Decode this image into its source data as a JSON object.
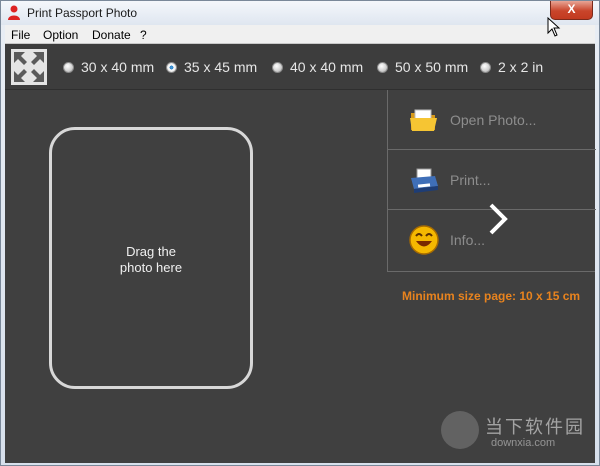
{
  "window": {
    "title": "Print Passport Photo",
    "close_label": "X"
  },
  "menu": [
    "File",
    "Option",
    "Donate",
    "?"
  ],
  "sizes": {
    "options": [
      "30 x 40 mm",
      "35 x 45 mm",
      "40 x 40 mm",
      "50 x 50 mm",
      "2 x 2 in"
    ],
    "selected": "35 x 45 mm"
  },
  "drop_zone": {
    "line1": "Drag the",
    "line2": "photo here"
  },
  "actions": {
    "open": "Open Photo...",
    "print": "Print...",
    "info": "Info..."
  },
  "min_size_text": "Minimum size page: 10 x 15 cm",
  "watermark": {
    "title": "当下软件园",
    "subtitle": "downxia.com"
  },
  "colors": {
    "accent_orange": "#e8831e",
    "client_bg": "#404040",
    "selected_radio": "#2a7fc5"
  }
}
